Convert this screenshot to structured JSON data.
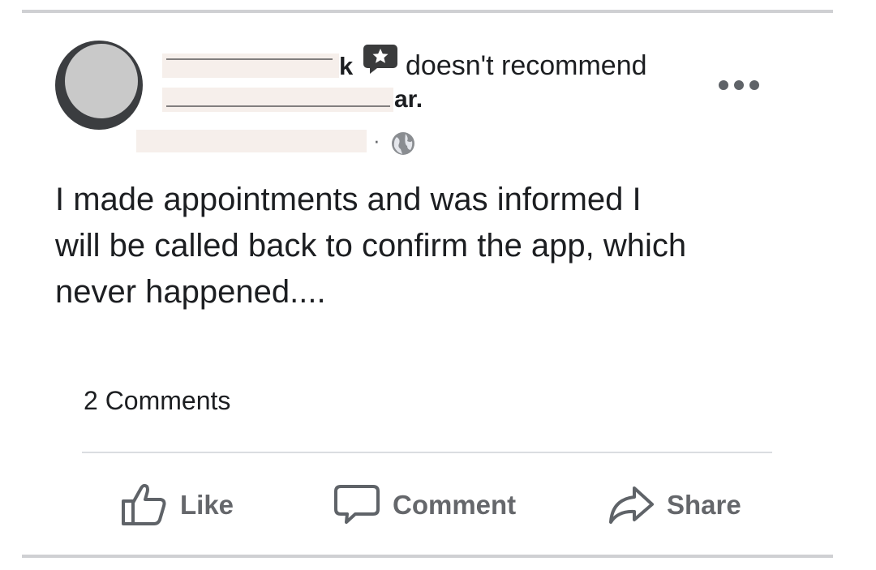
{
  "post": {
    "author_visible_suffix": "k",
    "author_line2_suffix": "ar.",
    "action_text": "doesn't recommend",
    "body_lines": [
      "I made appointments and was informed I",
      "will be called back to confirm the app, which",
      "never happened...."
    ],
    "separator": "·"
  },
  "footer": {
    "comments_count": "2 Comments"
  },
  "actions": {
    "like_label": "Like",
    "comment_label": "Comment",
    "share_label": "Share"
  },
  "icons": {
    "recommend": "speech-bubble-star-icon",
    "audience": "globe-icon",
    "more": "more-options-icon",
    "like": "thumbs-up-icon",
    "comment": "comment-bubble-icon",
    "share": "share-arrow-icon"
  },
  "colors": {
    "text_primary": "#1c1e21",
    "text_secondary": "#65676b",
    "divider": "#dadde1",
    "redaction": "#f6efeb"
  }
}
